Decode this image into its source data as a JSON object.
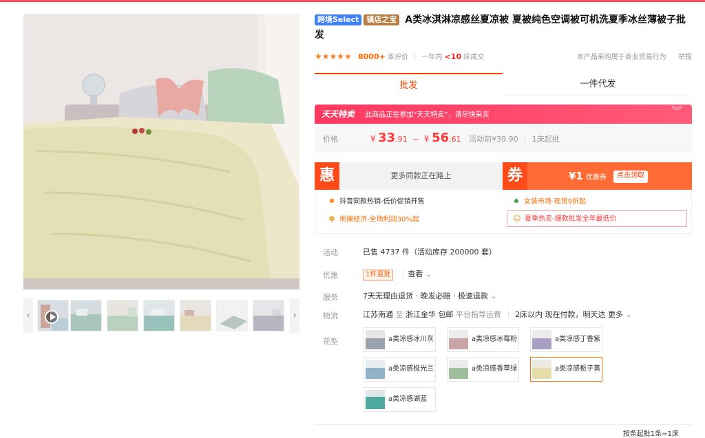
{
  "product": {
    "tag_cross_border": "跨境Select",
    "tag_store": "镇店之宝",
    "title": "A类冰淇淋凉感丝夏凉被 夏被纯色空调被可机洗夏季冰丝薄被子批发"
  },
  "rating": {
    "stars": "★★★★★",
    "count": "8000+",
    "count_suffix": "条评价",
    "year_prefix": "一年内",
    "year_count": "<10",
    "year_suffix": "床成交",
    "notice": "本产品采购属于商业贸易行为",
    "report": "举报"
  },
  "tabs": {
    "wholesale": "批发",
    "dropship": "一件代发"
  },
  "promo": {
    "brand": "天天特卖",
    "text": "此商品正在参加“天天特卖”，请尽快采买",
    "chevron": "︾",
    "price_label": "价格",
    "price_low_cur": "¥",
    "price_low_int": "33",
    "price_low_dec": ".91",
    "tilde": "~",
    "price_high_cur": "¥",
    "price_high_int": "56",
    "price_high_dec": ".61",
    "before": "活动前¥39.90",
    "min_order": "1床起批"
  },
  "benefits": {
    "hui_badge": "惠",
    "hui_text": "更多同款正在路上",
    "quan_badge": "券",
    "coupon_amount": "¥1",
    "coupon_label": "优惠券",
    "claim": "点击领取"
  },
  "activities": [
    {
      "icon": "✹",
      "text": "抖音同款热销-低价促销开售"
    },
    {
      "icon": "♠",
      "text": "女装市场-现货9折起"
    },
    {
      "icon": "✽",
      "text": "地摊经济-全场利润30%起"
    },
    {
      "icon": "☺",
      "text": "夏季热卖-爆款批发全年最低价"
    }
  ],
  "details": {
    "activity_label": "活动",
    "activity_value": "已售 4737 件（活动库存 200000 套）",
    "discount_label": "优惠",
    "discount_tag": "1件混批",
    "discount_view": "查看",
    "service_label": "服务",
    "service_value": "7天无理由退货 · 晚发必赔 · 极速退款",
    "logistics_label": "物流",
    "logistics_from": "江苏南通",
    "logistics_to_word": "至",
    "logistics_to": "浙江金华",
    "logistics_free": "包邮",
    "logistics_guide": "平台指导运费",
    "logistics_time": "2床以内 现在付款，明天达",
    "logistics_more": "更多",
    "pattern_label": "花型"
  },
  "skus": [
    {
      "label": "a类凉感冰川灰",
      "color": "#9aa3ad"
    },
    {
      "label": "a类凉感冰莓粉",
      "color": "#c9a5a8"
    },
    {
      "label": "a类凉感丁香紫",
      "color": "#a99fc2"
    },
    {
      "label": "a类凉感极光兰",
      "color": "#8fb4c8"
    },
    {
      "label": "a类凉感香草绿",
      "color": "#9fbf9c"
    },
    {
      "label": "a类凉感栀子黄",
      "color": "#e6dca8"
    },
    {
      "label": "a类凉感湖蓝",
      "color": "#4fa8a0"
    }
  ],
  "footer_note": "按条起批1条=1床",
  "nav": {
    "prev": "‹",
    "next": "›",
    "dropdown": "⌄"
  },
  "colors": {
    "accent": "#ff4000",
    "promo": "#ff3960",
    "price": "#ff3a3a"
  }
}
